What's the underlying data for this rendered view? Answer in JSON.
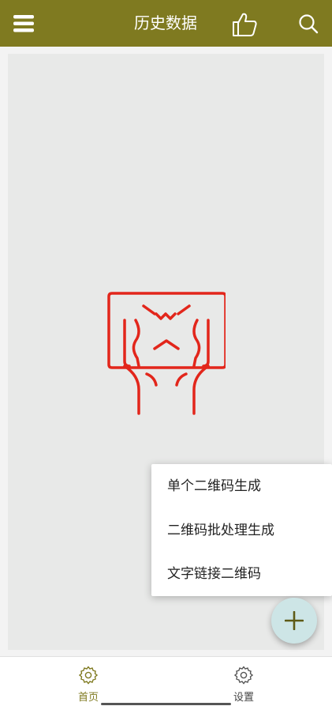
{
  "header": {
    "title": "历史数据",
    "icons": {
      "menu": "hamburger-menu-icon",
      "like": "thumbs-up-icon",
      "search": "search-icon"
    }
  },
  "empty_state": {
    "illustration": "crying-face-icon",
    "color": "#e2261b"
  },
  "popup_menu": {
    "items": [
      {
        "label": "单个二维码生成"
      },
      {
        "label": "二维码批处理生成"
      },
      {
        "label": "文字链接二维码"
      }
    ]
  },
  "fab": {
    "icon": "plus-icon",
    "background": "#cde5e6"
  },
  "bottom_nav": {
    "items": [
      {
        "label": "首页",
        "icon": "gear-icon",
        "active": true
      },
      {
        "label": "设置",
        "icon": "gear-icon",
        "active": false
      }
    ]
  },
  "colors": {
    "primary": "#7f7a20",
    "nav_active": "#7f7a20",
    "nav_inactive": "#444444"
  }
}
